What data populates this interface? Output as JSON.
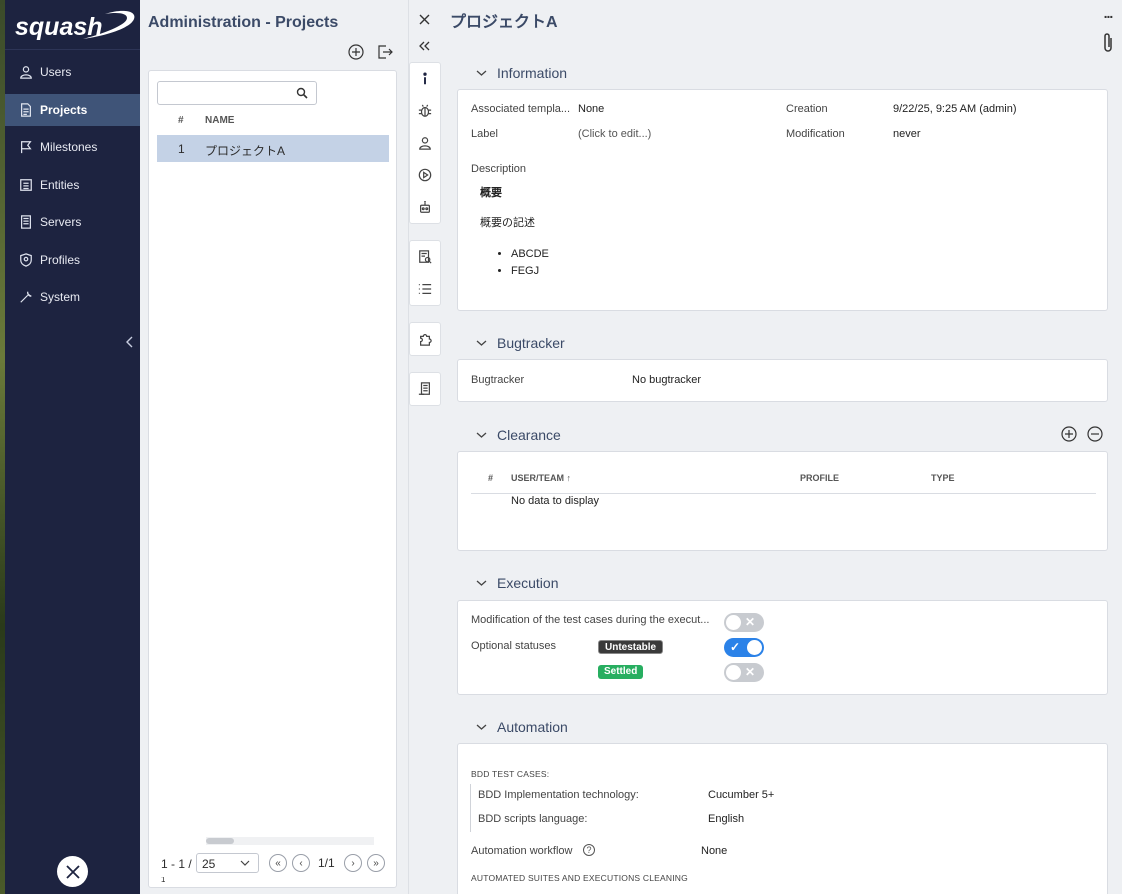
{
  "app": {
    "logo_text": "squash"
  },
  "sidebar": {
    "items": [
      {
        "label": "Users",
        "icon": "user-icon"
      },
      {
        "label": "Projects",
        "icon": "document-icon",
        "active": true
      },
      {
        "label": "Milestones",
        "icon": "flag-icon"
      },
      {
        "label": "Entities",
        "icon": "list-box-icon"
      },
      {
        "label": "Servers",
        "icon": "server-icon"
      },
      {
        "label": "Profiles",
        "icon": "shield-user-icon"
      },
      {
        "label": "System",
        "icon": "wrench-icon"
      }
    ]
  },
  "projects": {
    "title": "Administration - Projects",
    "search_placeholder": "",
    "columns": [
      "#",
      "NAME"
    ],
    "rows": [
      {
        "index": "1",
        "name": "プロジェクトA"
      }
    ],
    "pager": {
      "range": "1 - 1 /",
      "range_total": "1",
      "page_size": "25",
      "page_count": "1/1"
    }
  },
  "detail": {
    "title": "プロジェクトA",
    "more_label": "...",
    "information": {
      "heading": "Information",
      "associated_template_label": "Associated templa...",
      "associated_template_value": "None",
      "label_label": "Label",
      "label_value": "(Click to edit...)",
      "creation_label": "Creation",
      "creation_value": "9/22/25, 9:25 AM (admin)",
      "modification_label": "Modification",
      "modification_value": "never",
      "description_label": "Description",
      "description_heading": "概要",
      "description_text": "概要の記述",
      "description_items": [
        "ABCDE",
        "FEGJ"
      ]
    },
    "bugtracker": {
      "heading": "Bugtracker",
      "label": "Bugtracker",
      "value": "No bugtracker"
    },
    "clearance": {
      "heading": "Clearance",
      "columns": {
        "index": "#",
        "user_team": "USER/TEAM",
        "sort_indicator": "↑",
        "profile": "PROFILE",
        "type": "TYPE"
      },
      "empty_text": "No data to display"
    },
    "execution": {
      "heading": "Execution",
      "modification_label": "Modification of the test cases during the execut...",
      "modification_enabled": false,
      "optional_statuses_label": "Optional statuses",
      "statuses": [
        {
          "label": "Untestable",
          "enabled": true,
          "color": "#3a3a3a"
        },
        {
          "label": "Settled",
          "enabled": false,
          "color": "#27ae60"
        }
      ]
    },
    "automation": {
      "heading": "Automation",
      "bdd_section_label": "BDD TEST CASES:",
      "bdd_tech_label": "BDD Implementation technology:",
      "bdd_tech_value": "Cucumber 5+",
      "bdd_lang_label": "BDD scripts language:",
      "bdd_lang_value": "English",
      "workflow_label": "Automation workflow",
      "workflow_value": "None",
      "cleaning_label": "AUTOMATED SUITES AND EXECUTIONS CLEANING"
    }
  },
  "colors": {
    "sidebar_bg": "#1d2340",
    "active_item": "#3f5478",
    "title": "#3b4a67",
    "selected_row": "#c4d2e6",
    "toggle_on": "#2b82e8"
  }
}
